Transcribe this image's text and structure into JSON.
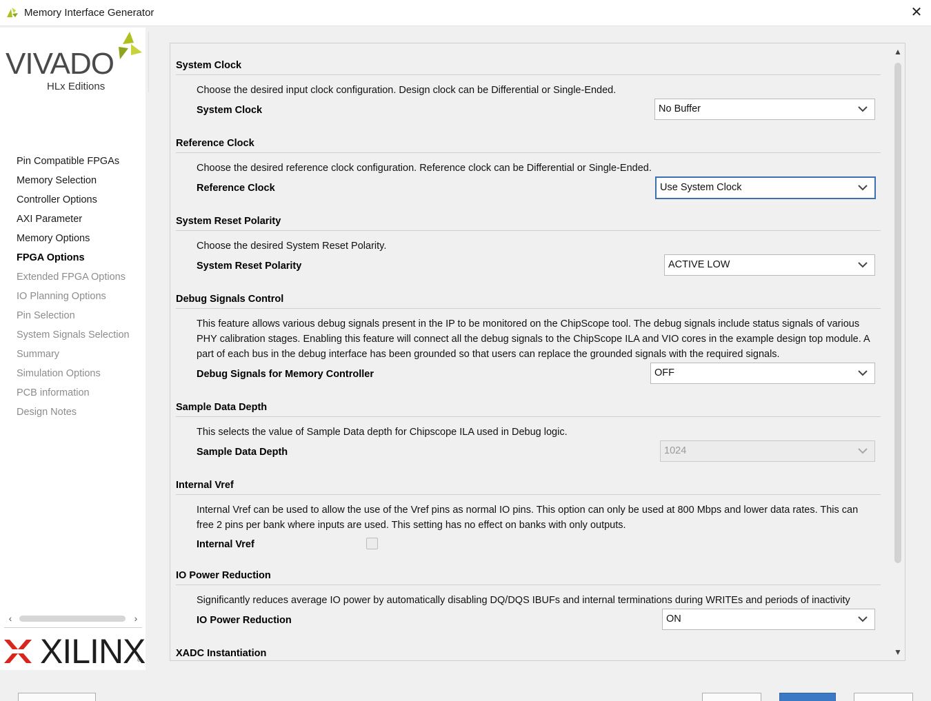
{
  "window": {
    "title": "Memory Interface Generator",
    "close_glyph": "✕",
    "icon": "vivado-leaf-icon"
  },
  "sidebar": {
    "logo": {
      "brand": "VIVADO",
      "subtitle": "HLx Editions"
    },
    "nav": [
      {
        "label": "Pin Compatible FPGAs",
        "state": "done"
      },
      {
        "label": "Memory Selection",
        "state": "done"
      },
      {
        "label": "Controller Options",
        "state": "done"
      },
      {
        "label": "AXI Parameter",
        "state": "done"
      },
      {
        "label": "Memory Options",
        "state": "done"
      },
      {
        "label": "FPGA Options",
        "state": "current"
      },
      {
        "label": "Extended FPGA Options",
        "state": "todo"
      },
      {
        "label": "IO Planning Options",
        "state": "todo"
      },
      {
        "label": "Pin Selection",
        "state": "todo"
      },
      {
        "label": "System Signals Selection",
        "state": "todo"
      },
      {
        "label": "Summary",
        "state": "todo"
      },
      {
        "label": "Simulation Options",
        "state": "todo"
      },
      {
        "label": "PCB information",
        "state": "todo"
      },
      {
        "label": "Design Notes",
        "state": "todo"
      }
    ],
    "scroll_left": "‹",
    "scroll_right": "›",
    "footer_logo": {
      "brand": "XILINX",
      "mark": "®"
    }
  },
  "sections": [
    {
      "title": "System Clock",
      "description": "Choose the desired input clock configuration. Design clock can be Differential or Single-Ended.",
      "field_label": "System Clock",
      "value": "No Buffer"
    },
    {
      "title": "Reference Clock",
      "description": "Choose the desired reference clock configuration. Reference clock can be Differential or Single-Ended.",
      "field_label": "Reference Clock",
      "value": "Use System Clock"
    },
    {
      "title": "System Reset Polarity",
      "description": "Choose the desired System Reset Polarity.",
      "field_label": "System Reset Polarity",
      "value": "ACTIVE LOW"
    },
    {
      "title": "Debug Signals Control",
      "description": "This feature allows various debug signals present in the IP to be monitored on the ChipScope tool. The debug signals include status signals of various PHY calibration stages. Enabling this feature will connect all the debug signals to the ChipScope ILA and VIO cores in the example design top module. A part of each bus in the debug interface has been grounded so that users can replace the grounded signals with the required signals.",
      "field_label": "Debug Signals for Memory Controller",
      "value": "OFF"
    },
    {
      "title": "Sample Data Depth",
      "description": "This selects the value of Sample Data depth for Chipscope ILA used in Debug logic.",
      "field_label": "Sample Data Depth",
      "value": "1024"
    },
    {
      "title": "Internal Vref",
      "description": "Internal Vref can be used to allow the use of the Vref pins as normal IO pins. This option can only be used at 800 Mbps and lower data rates. This can free 2 pins per bank where inputs are used. This setting has no effect on banks with only outputs.",
      "field_label": "Internal Vref",
      "checked": false
    },
    {
      "title": "IO Power Reduction",
      "description": "Significantly reduces average IO power by automatically disabling DQ/DQS IBUFs and internal terminations during WRITEs and periods of inactivity",
      "field_label": "IO Power Reduction",
      "value": "ON"
    },
    {
      "title": "XADC Instantiation"
    }
  ],
  "scrollbar": {
    "up": "▲",
    "down": "▼"
  },
  "colors": {
    "focus_border": "#3d6fb3",
    "primary_button": "#3c79c4",
    "xilinx_red": "#d7261d",
    "vivado_green": "#aebf1e"
  }
}
